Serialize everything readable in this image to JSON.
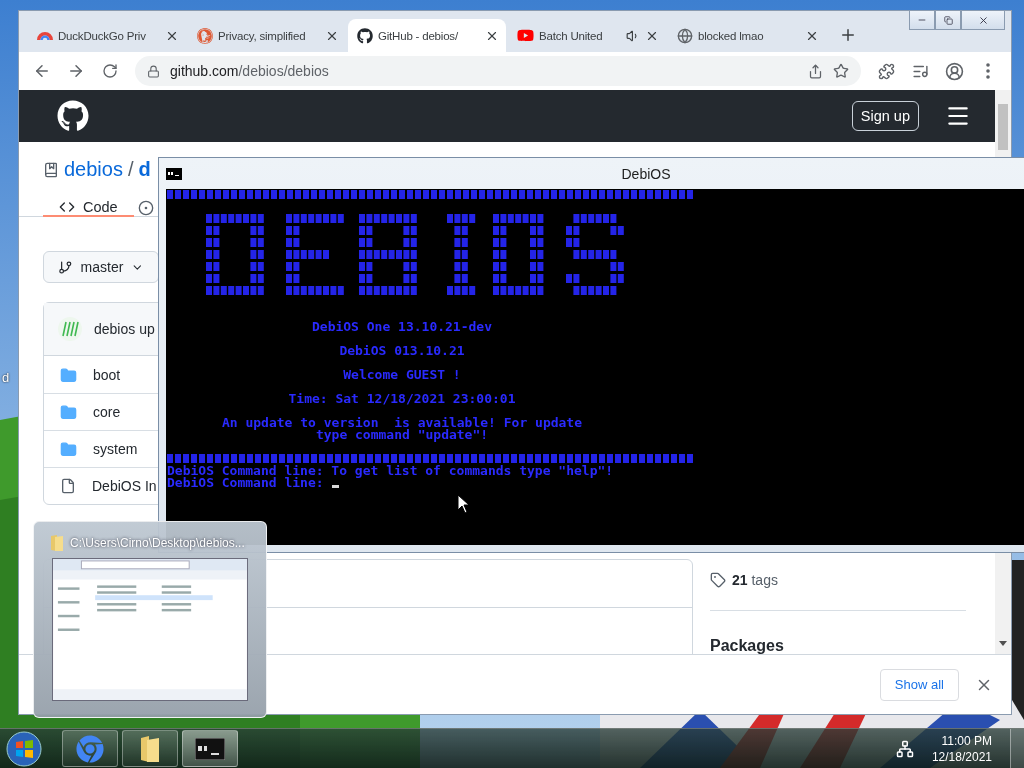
{
  "desktop": {
    "icon_label": "d"
  },
  "browser": {
    "tabs": [
      {
        "title": "DuckDuckGo Priv",
        "selected": false,
        "audio": false
      },
      {
        "title": "Privacy, simplified",
        "selected": false,
        "audio": false
      },
      {
        "title": "GitHub - debios/",
        "selected": true,
        "audio": false
      },
      {
        "title": "Batch United",
        "selected": false,
        "audio": true
      },
      {
        "title": "blocked lmao",
        "selected": false,
        "audio": false
      }
    ],
    "url": {
      "host": "github.com",
      "path": "/debios/debios"
    },
    "page": {
      "sign_up": "Sign up",
      "repo": {
        "owner": "debios",
        "separator": "/",
        "name": "d"
      },
      "nav_tabs": [
        {
          "label": "Code",
          "selected": true
        }
      ],
      "branch": "master",
      "commit": {
        "text": "debios up"
      },
      "files": [
        {
          "name": "boot",
          "kind": "folder"
        },
        {
          "name": "core",
          "kind": "folder"
        },
        {
          "name": "system",
          "kind": "folder"
        },
        {
          "name": "DebiOS In",
          "kind": "file"
        }
      ],
      "sidebar": {
        "tags": "**21** tags",
        "packages": "Packages"
      }
    },
    "download_bar": {
      "button": "Show all"
    }
  },
  "console": {
    "title": "DebiOS",
    "lines": [
      {
        "kind": "separator"
      },
      {
        "kind": "blank"
      },
      {
        "kind": "logo"
      },
      {
        "kind": "blank"
      },
      {
        "kind": "blank"
      },
      {
        "kind": "text",
        "text": "DebiOS One 13.10.21-dev"
      },
      {
        "kind": "blank"
      },
      {
        "kind": "text",
        "text": "DebiOS 013.10.21"
      },
      {
        "kind": "blank"
      },
      {
        "kind": "text",
        "text": "Welcome GUEST !"
      },
      {
        "kind": "blank"
      },
      {
        "kind": "text",
        "text": "Time: Sat 12/18/2021 23:00:01"
      },
      {
        "kind": "blank"
      },
      {
        "kind": "text",
        "text": "An update to version  is available! For update"
      },
      {
        "kind": "text",
        "text": "type command \"update\"!"
      },
      {
        "kind": "blank"
      },
      {
        "kind": "separator"
      },
      {
        "kind": "prompt",
        "text": "DebiOS Command line: To get list of commands type \"help\"!",
        "cursor": false
      },
      {
        "kind": "prompt",
        "text": "DebiOS Command line:",
        "cursor": true
      }
    ]
  },
  "thumbnail": {
    "title": "C:\\Users\\Cirno\\Desktop\\debios..."
  },
  "taskbar": {
    "apps": [
      {
        "kind": "chrome",
        "active": false
      },
      {
        "kind": "folder",
        "active": false
      },
      {
        "kind": "console",
        "active": true
      }
    ],
    "time": "11:00 PM",
    "date": "12/18/2021"
  }
}
